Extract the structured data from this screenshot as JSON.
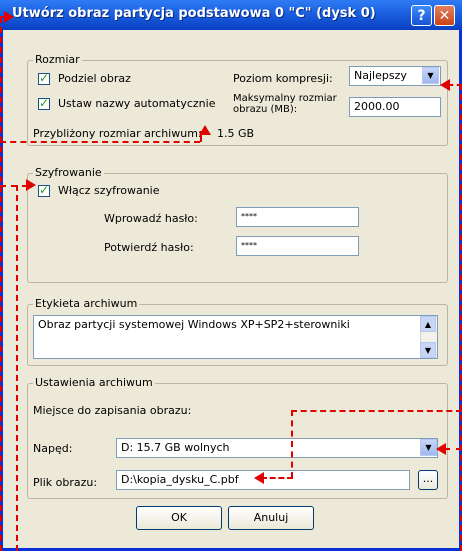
{
  "window": {
    "title": "Utwórz obraz partycja podstawowa  0  \"C\" (dysk 0)",
    "help": "?",
    "close": "✕"
  },
  "rozmiar": {
    "legend": "Rozmiar",
    "podziel_label": "Podziel obraz",
    "ustaw_label": "Ustaw nazwy automatycznie",
    "kompresja_label": "Poziom kompresji:",
    "kompresja_value": "Najlepszy",
    "max_label": "Maksymalny rozmiar obrazu (MB):",
    "max_value": "2000.00",
    "approx_label": "Przybliżony rozmiar archiwum:",
    "approx_value": "1.5 GB"
  },
  "szyfrowanie": {
    "legend": "Szyfrowanie",
    "enable_label": "Włącz szyfrowanie",
    "haslo_label": "Wprowadź hasło:",
    "haslo_value": "****",
    "potwierdz_label": "Potwierdź hasło:",
    "potwierdz_value": "****"
  },
  "etykieta": {
    "legend": "Etykieta archiwum",
    "value": "Obraz partycji systemowej Windows XP+SP2+sterowniki"
  },
  "ustawienia": {
    "legend": "Ustawienia archiwum",
    "miejsce_label": "Miejsce do zapisania obrazu:",
    "naped_label": "Napęd:",
    "naped_value": "D: 15.7 GB wolnych",
    "plik_label": "Plik obrazu:",
    "plik_value": "D:\\kopia_dysku_C.pbf",
    "browse": "..."
  },
  "buttons": {
    "ok": "OK",
    "cancel": "Anuluj"
  }
}
